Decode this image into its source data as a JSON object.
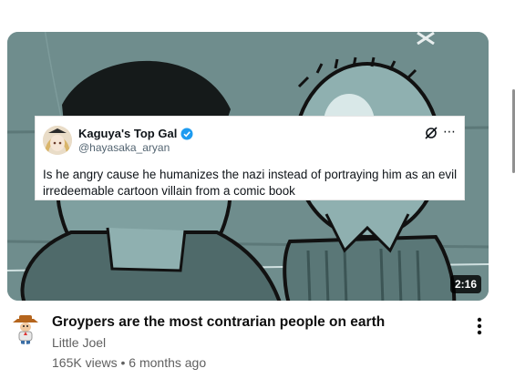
{
  "thumbnail": {
    "duration": "2:16",
    "tweet": {
      "display_name": "Kaguya's Top Gal",
      "handle": "@hayasaka_aryan",
      "text": "Is he angry cause he humanizes the nazi instead of portraying him as an evil irredeemable cartoon villain from a comic book"
    }
  },
  "video": {
    "title": "Groypers are the most contrarian people on earth",
    "channel": "Little Joel",
    "views": "165K views",
    "separator": "•",
    "age": "6 months ago"
  },
  "colors": {
    "thumbnail_bg": "#6f8d8d",
    "verified_blue": "#1d9bf0",
    "title_text": "#0f0f0f",
    "meta_text": "#606060"
  },
  "icons": {
    "verified": "verified-badge-icon",
    "grok": "grok-icon",
    "more": "more-horizontal-icon",
    "video_menu": "more-vertical-icon"
  }
}
